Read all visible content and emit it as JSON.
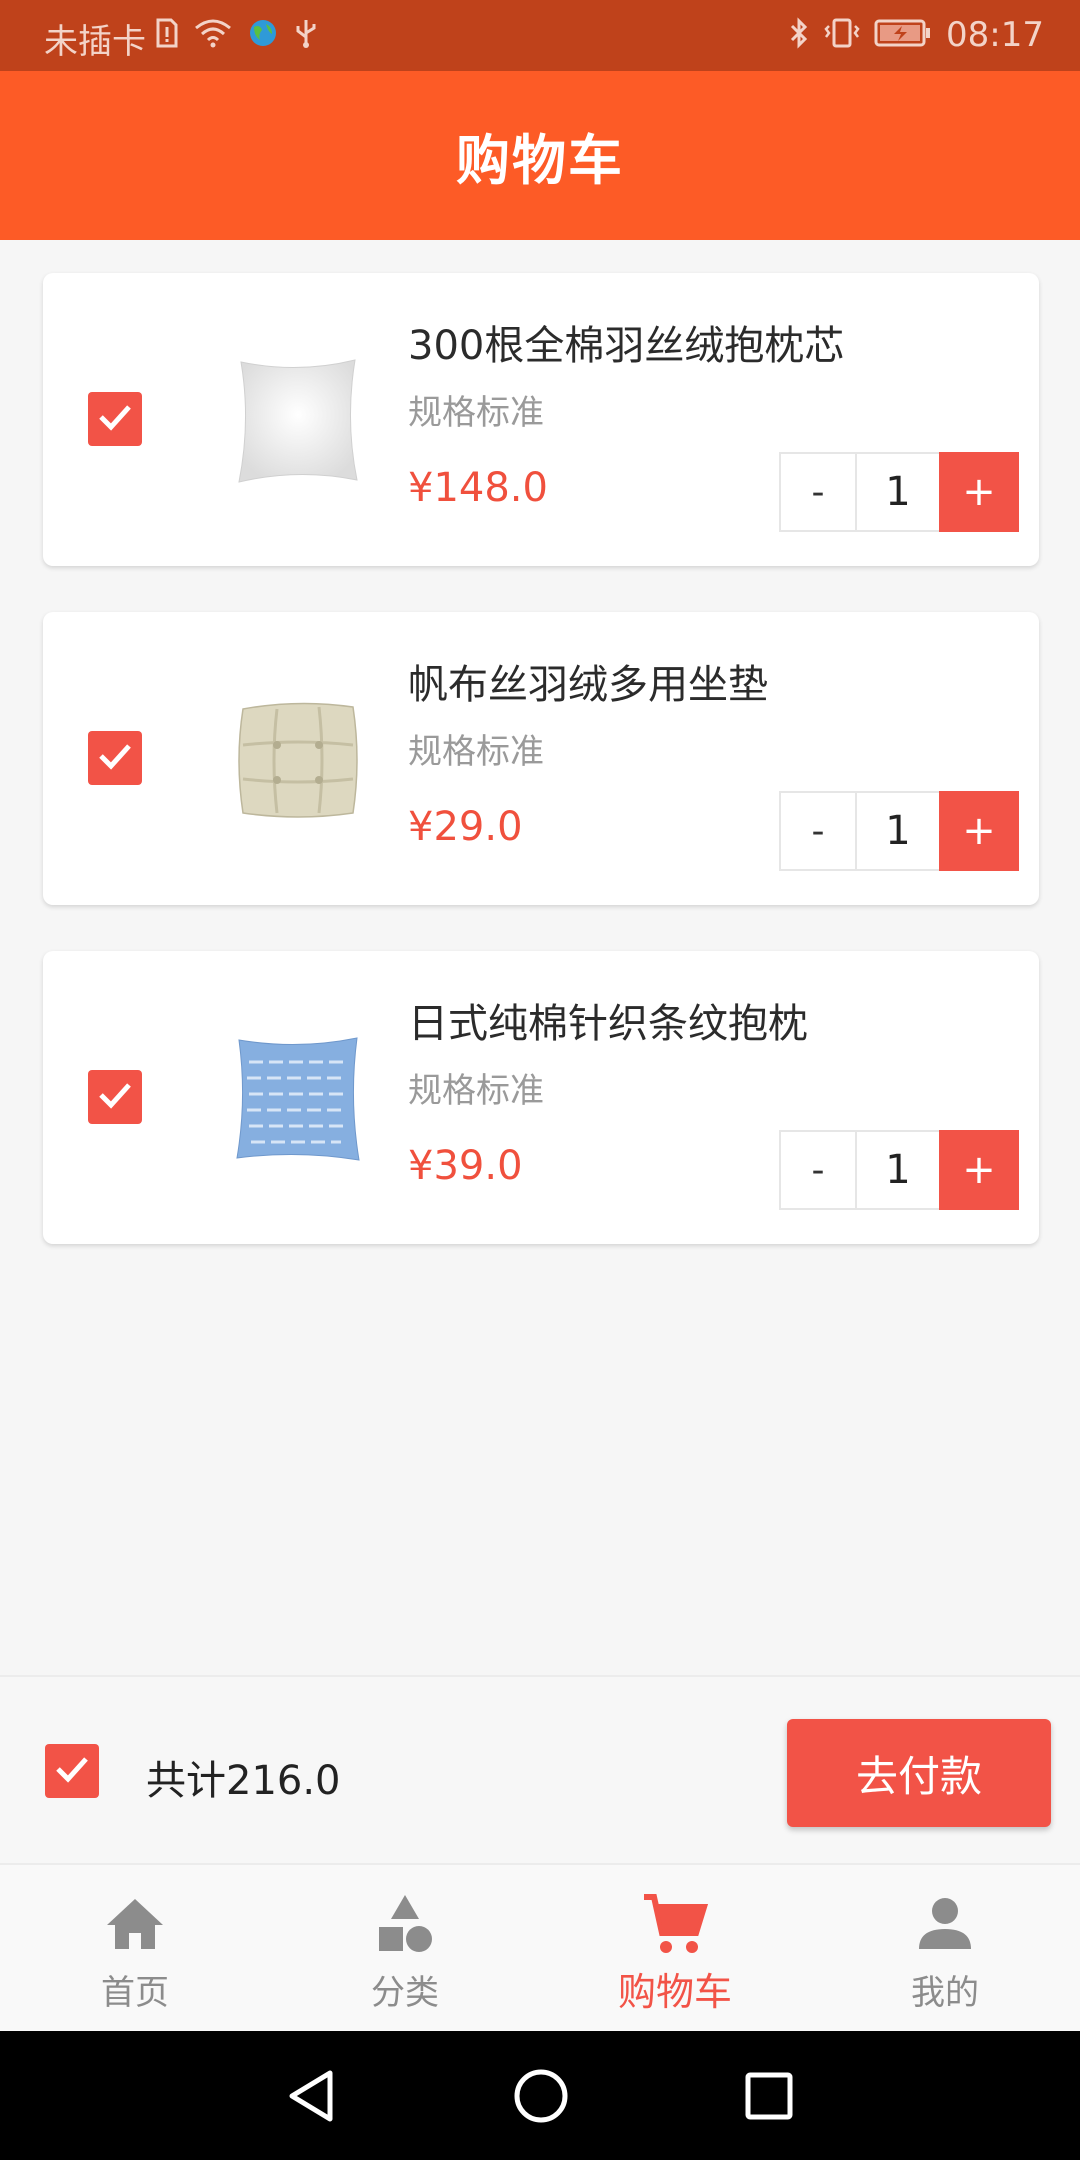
{
  "status_bar": {
    "carrier": "未插卡",
    "time": "08:17"
  },
  "header": {
    "title": "购物车"
  },
  "cart": {
    "items": [
      {
        "name": "300根全棉羽丝绒抱枕芯",
        "spec": "规格标准",
        "price": "¥148.0",
        "quantity": "1",
        "checked": true,
        "image": "white-pillow"
      },
      {
        "name": "帆布丝羽绒多用坐垫",
        "spec": "规格标准",
        "price": "¥29.0",
        "quantity": "1",
        "checked": true,
        "image": "beige-cushion"
      },
      {
        "name": "日式纯棉针织条纹抱枕",
        "spec": "规格标准",
        "price": "¥39.0",
        "quantity": "1",
        "checked": true,
        "image": "blue-striped-pillow"
      }
    ],
    "minus_label": "-",
    "plus_label": "+"
  },
  "footer": {
    "select_all_checked": true,
    "total_label": "共计216.0",
    "pay_button": "去付款"
  },
  "tabs": [
    {
      "label": "首页",
      "icon": "home-icon",
      "active": false
    },
    {
      "label": "分类",
      "icon": "category-icon",
      "active": false
    },
    {
      "label": "购物车",
      "icon": "cart-icon",
      "active": true
    },
    {
      "label": "我的",
      "icon": "person-icon",
      "active": false
    }
  ],
  "colors": {
    "status_bar": "#bf421b",
    "header": "#fd5b26",
    "accent": "#f25347",
    "price": "#f0503d"
  }
}
